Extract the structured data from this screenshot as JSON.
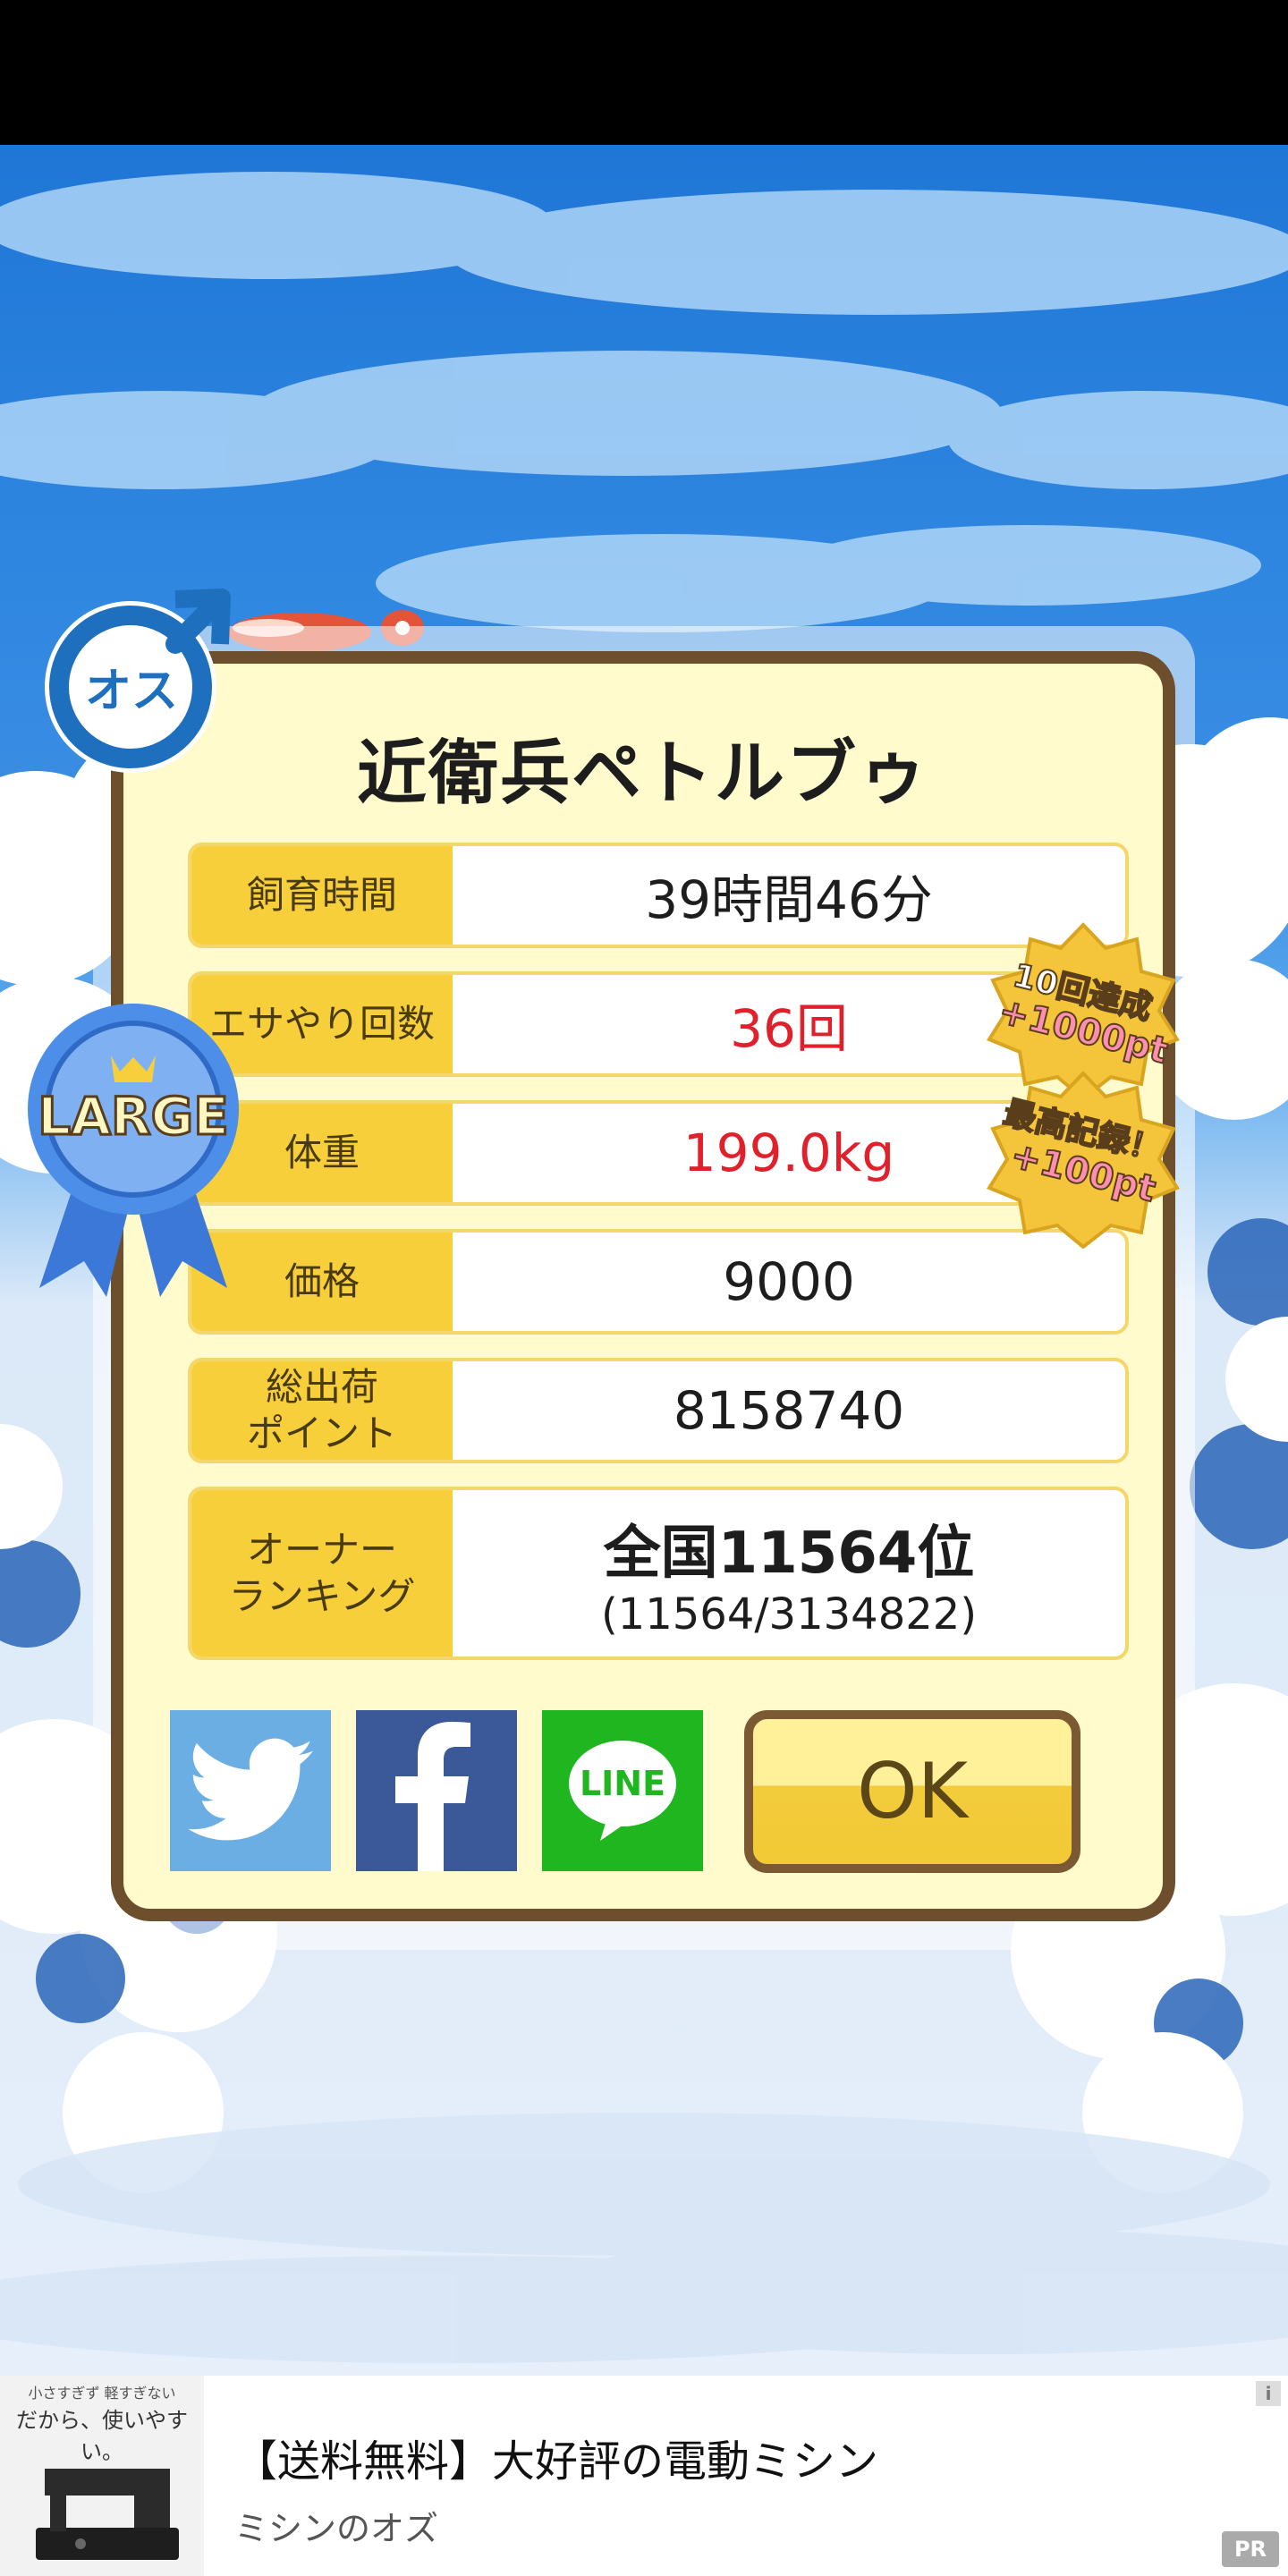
{
  "pet_name": "近衛兵ペトルブゥ",
  "gender_badge": "オス",
  "size_badge": "LARGE",
  "stats": [
    {
      "label": "飼育時間",
      "value": "39時間46分"
    },
    {
      "label": "エサやり回数",
      "value": "36回"
    },
    {
      "label": "体重",
      "value": "199.0kg"
    },
    {
      "label": "価格",
      "value": "9000"
    },
    {
      "label_line1": "総出荷",
      "label_line2": "ポイント",
      "value": "8158740"
    },
    {
      "label_line1": "オーナー",
      "label_line2": "ランキング",
      "value_main": "全国11564位",
      "value_sub": "(11564/3134822)"
    }
  ],
  "bonus_badges": [
    {
      "line1": "10回達成",
      "line2": "+1000pt"
    },
    {
      "line1": "最高記録！",
      "line2": "+100pt"
    }
  ],
  "share_buttons": [
    "twitter-icon",
    "facebook-icon",
    "line-icon"
  ],
  "line_label": "LINE",
  "ok_label": "OK",
  "ad": {
    "image_top": "小さすぎず 軽すぎない",
    "image_caption": "だから、使いやすい。",
    "title": "【送料無料】大好評の電動ミシン",
    "advertiser": "ミシンのオズ",
    "pr": "PR",
    "info": "i"
  },
  "colors": {
    "accent_red": "#e0202a",
    "label_yellow": "#f6cf3a",
    "card_bg": "#fffbcc",
    "card_border": "#6e4f2d"
  }
}
